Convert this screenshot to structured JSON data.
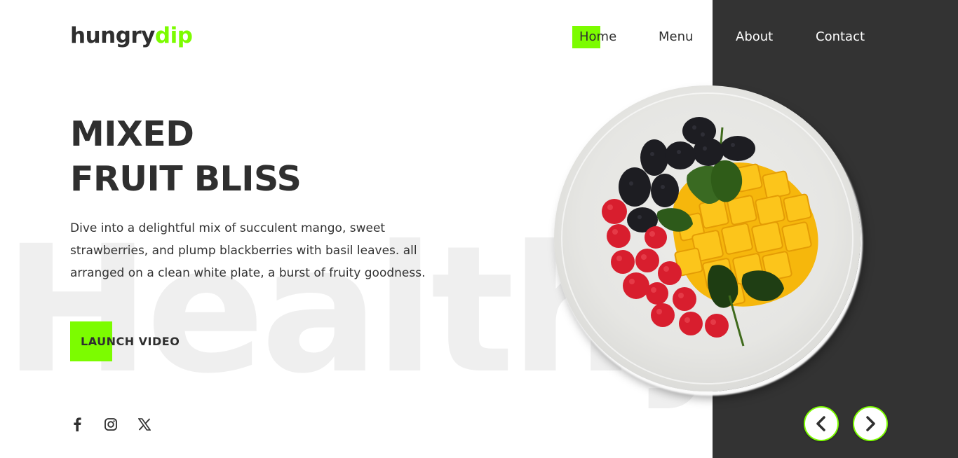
{
  "brand": {
    "part1": "hungry",
    "part2": "dip",
    "accent_color": "#7cfc00",
    "dark_color": "#333333"
  },
  "nav": {
    "items": [
      {
        "label": "Home",
        "active": true
      },
      {
        "label": "Menu"
      },
      {
        "label": "About"
      },
      {
        "label": "Contact"
      }
    ]
  },
  "hero": {
    "title_line1": "MIXED",
    "title_line2": "FRUIT BLISS",
    "description": "Dive into a delightful mix of succulent mango, sweet strawberries, and plump blackberries with basil leaves. all arranged on a clean white plate, a burst of fruity goodness.",
    "cta_label": "LAUNCH VIDEO",
    "watermark": "Healthy"
  },
  "socials": [
    {
      "icon": "facebook-icon"
    },
    {
      "icon": "instagram-icon"
    },
    {
      "icon": "x-twitter-icon"
    }
  ],
  "carousel": {
    "prev_icon": "chevron-left-icon",
    "next_icon": "chevron-right-icon"
  }
}
